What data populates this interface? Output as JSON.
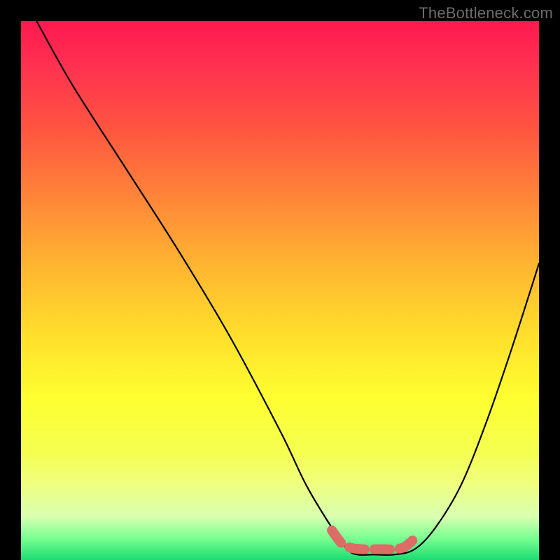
{
  "watermark": "TheBottleneck.com",
  "chart_data": {
    "type": "line",
    "title": "",
    "xlabel": "",
    "ylabel": "",
    "xlim": [
      0,
      100
    ],
    "ylim": [
      0,
      100
    ],
    "series": [
      {
        "name": "bottleneck-curve",
        "x": [
          3,
          10,
          20,
          30,
          40,
          50,
          55,
          60,
          63,
          65,
          68,
          72,
          76,
          80,
          85,
          90,
          95,
          100
        ],
        "y": [
          100,
          88,
          73,
          58,
          42,
          24,
          14,
          6,
          2,
          1,
          1,
          1,
          2,
          6,
          14,
          26,
          40,
          55
        ],
        "color": "#000000"
      },
      {
        "name": "optimal-band",
        "x": [
          60,
          62,
          64,
          66,
          68,
          70,
          72,
          74,
          76
        ],
        "y": [
          5.5,
          3.0,
          2.2,
          2.0,
          2.0,
          2.0,
          2.0,
          2.4,
          4.0
        ],
        "color": "#dd6b66"
      }
    ],
    "background_gradient": {
      "top_color": "#ff1850",
      "mid_color": "#feff30",
      "bottom_color": "#1cdc73"
    }
  }
}
